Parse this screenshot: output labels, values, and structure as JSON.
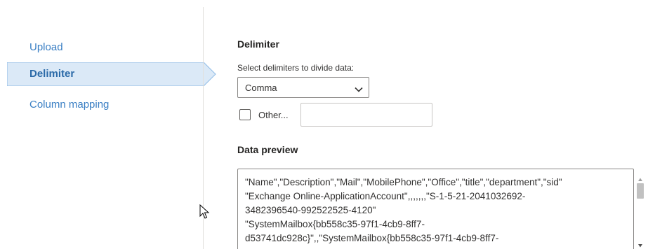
{
  "nav": {
    "items": [
      {
        "label": "Upload",
        "active": false
      },
      {
        "label": "Delimiter",
        "active": true
      },
      {
        "label": "Column mapping",
        "active": false
      }
    ]
  },
  "delimiter": {
    "title": "Delimiter",
    "subtitle": "Select delimiters to divide data:",
    "selected": "Comma",
    "other_label": "Other...",
    "other_checked": false,
    "other_value": ""
  },
  "preview": {
    "title": "Data preview",
    "lines": [
      "\"Name\",\"Description\",\"Mail\",\"MobilePhone\",\"Office\",\"title\",\"department\",\"sid\"",
      "\"Exchange Online-ApplicationAccount\",,,,,,,\"S-1-5-21-2041032692-",
      "3482396540-992522525-4120\"",
      "\"SystemMailbox{bb558c35-97f1-4cb9-8ff7-",
      "d53741dc928c}\",,\"SystemMailbox{bb558c35-97f1-4cb9-8ff7-"
    ]
  },
  "colors": {
    "accent": "#3a7fc4",
    "active_bg": "#dbe9f7",
    "active_border": "#8fbbe6"
  }
}
